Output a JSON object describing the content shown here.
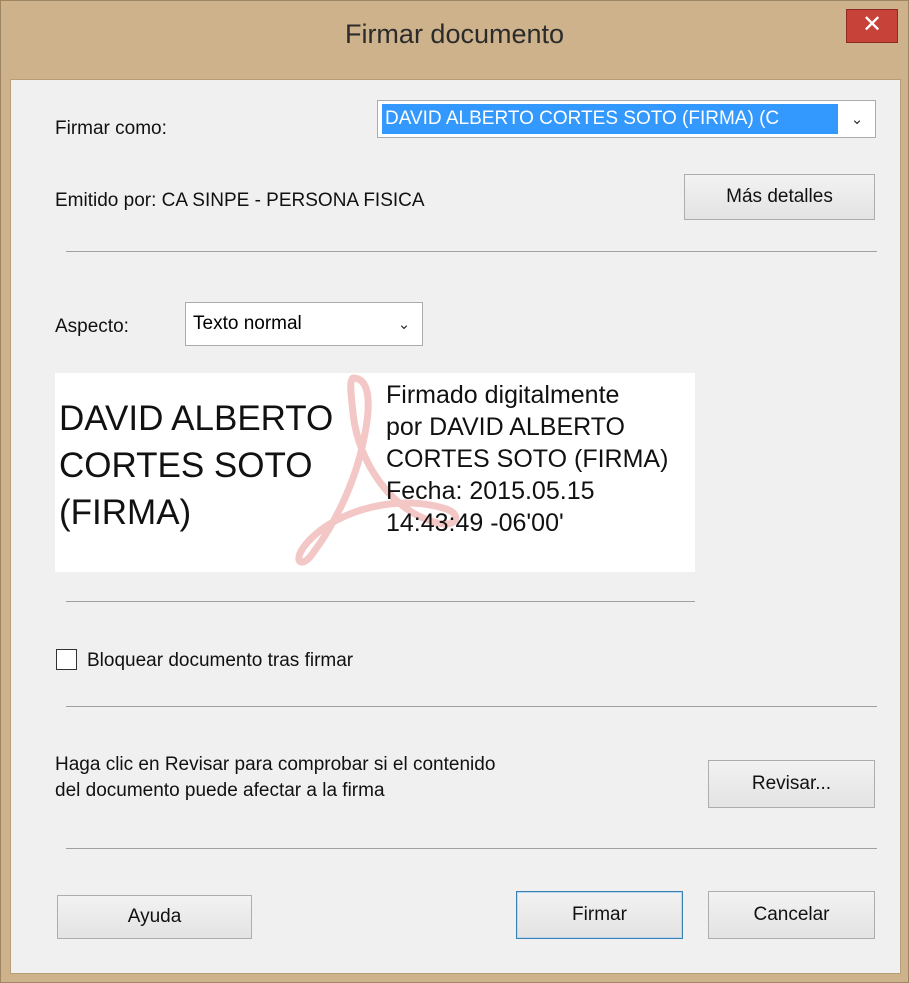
{
  "window": {
    "title": "Firmar documento",
    "close_glyph": "✕"
  },
  "sign_as": {
    "label": "Firmar como:",
    "selected_value": "DAVID ALBERTO CORTES SOTO (FIRMA) (C"
  },
  "issuer": {
    "text": "Emitido por: CA SINPE - PERSONA FISICA",
    "details_button": "Más detalles"
  },
  "appearance": {
    "label": "Aspecto:",
    "selected_value": "Texto normal"
  },
  "preview": {
    "name_lines": [
      "DAVID ALBERTO",
      "CORTES SOTO",
      "(FIRMA)"
    ],
    "info_lines": [
      "Firmado digitalmente",
      "por DAVID ALBERTO",
      "CORTES SOTO (FIRMA)",
      "Fecha: 2015.05.15",
      "14:43:49 -06'00'"
    ]
  },
  "lock": {
    "label": "Bloquear documento tras firmar",
    "checked": false
  },
  "review": {
    "text_lines": [
      "Haga clic en Revisar para comprobar si el contenido",
      "del documento puede afectar a la firma"
    ],
    "button": "Revisar..."
  },
  "footer": {
    "help_button": "Ayuda",
    "sign_button": "Firmar",
    "cancel_button": "Cancelar"
  },
  "icons": {
    "dropdown": "chevron-down-icon",
    "watermark": "adobe-acrobat-logo"
  },
  "colors": {
    "titlebar": "#cdb28b",
    "close_button": "#c7433a",
    "selection_highlight": "#3399ff",
    "dialog_background": "#f0f0f0"
  }
}
